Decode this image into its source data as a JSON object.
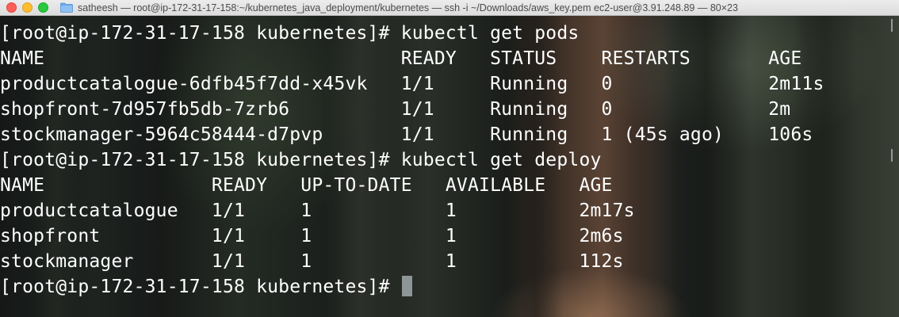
{
  "window": {
    "title": "satheesh — root@ip-172-31-17-158:~/kubernetes_java_deployment/kubernetes — ssh -i ~/Downloads/aws_key.pem ec2-user@3.91.248.89 — 80×23"
  },
  "terminal": {
    "lines": [
      "[root@ip-172-31-17-158 kubernetes]# kubectl get pods",
      "NAME                                READY   STATUS    RESTARTS       AGE",
      "productcatalogue-6dfb45f7dd-x45vk   1/1     Running   0              2m11s",
      "shopfront-7d957fb5db-7zrb6          1/1     Running   0              2m",
      "stockmanager-5964c58444-d7pvp       1/1     Running   1 (45s ago)    106s",
      "[root@ip-172-31-17-158 kubernetes]# kubectl get deploy",
      "NAME               READY   UP-TO-DATE   AVAILABLE   AGE",
      "productcatalogue   1/1     1            1           2m17s",
      "shopfront          1/1     1            1           2m6s",
      "stockmanager       1/1     1            1           112s"
    ],
    "prompt": "[root@ip-172-31-17-158 kubernetes]# "
  },
  "colors": {
    "text": "#ffffff",
    "cursor": "#8d9597",
    "close": "#fe5f57",
    "minimize": "#febc2e",
    "maximize": "#28c840"
  }
}
